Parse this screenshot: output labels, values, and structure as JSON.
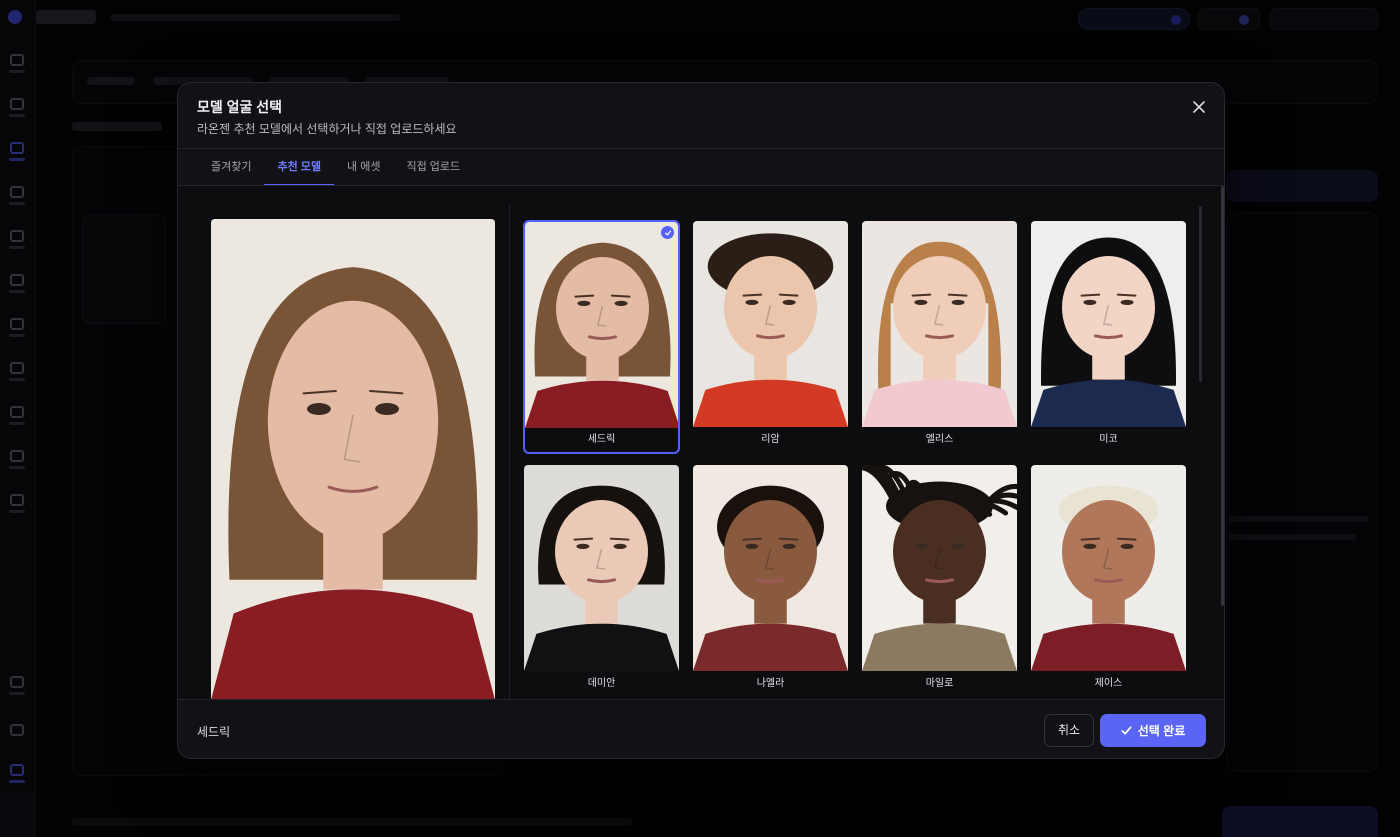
{
  "modal": {
    "title": "모델 얼굴 선택",
    "subtitle": "라온젠 추천 모델에서 선택하거나 직접 업로드하세요",
    "close_icon": "close-icon"
  },
  "tabs": [
    {
      "label": "즐겨찾기",
      "active": false
    },
    {
      "label": "추천 모델",
      "active": true
    },
    {
      "label": "내 에셋",
      "active": false
    },
    {
      "label": "직접 업로드",
      "active": false
    }
  ],
  "models": [
    {
      "name": "세드릭",
      "selected": true,
      "bg": "#ece7df",
      "hair": "#7a5436",
      "skin": "#e4bca6",
      "top": "#8a1c24",
      "style": "long"
    },
    {
      "name": "리암",
      "selected": false,
      "bg": "#e9e5e0",
      "hair": "#2b1e17",
      "skin": "#ebc5ac",
      "top": "#d33a24",
      "style": "curly"
    },
    {
      "name": "엘리스",
      "selected": false,
      "bg": "#ebe6e1",
      "hair": "#b9804a",
      "skin": "#f0cdb9",
      "top": "#f1c9cf",
      "style": "braid"
    },
    {
      "name": "미코",
      "selected": false,
      "bg": "#eeeeec",
      "hair": "#0e0e10",
      "skin": "#f3d5c6",
      "top": "#1d2a4f",
      "style": "bangs"
    },
    {
      "name": "데미안",
      "selected": false,
      "bg": "#dedcd9",
      "hair": "#17110d",
      "skin": "#eacab7",
      "top": "#111114",
      "style": "bob"
    },
    {
      "name": "나엘라",
      "selected": false,
      "bg": "#efe9e2",
      "hair": "#1a110c",
      "skin": "#8a5a3e",
      "top": "#7a2a2a",
      "style": "pulled"
    },
    {
      "name": "마일로",
      "selected": false,
      "bg": "#f2efea",
      "hair": "#17120f",
      "skin": "#4a2e22",
      "top": "#8b7a60",
      "style": "locs"
    },
    {
      "name": "제이스",
      "selected": false,
      "bg": "#efedea",
      "hair": "#e9e3d3",
      "skin": "#b0775a",
      "top": "#7d1d26",
      "style": "short"
    }
  ],
  "footer": {
    "selected_name": "세드릭",
    "cancel_label": "취소",
    "confirm_label": "선택 완료"
  },
  "colors": {
    "accent": "#5b65f5",
    "modal_bg": "#121216"
  }
}
